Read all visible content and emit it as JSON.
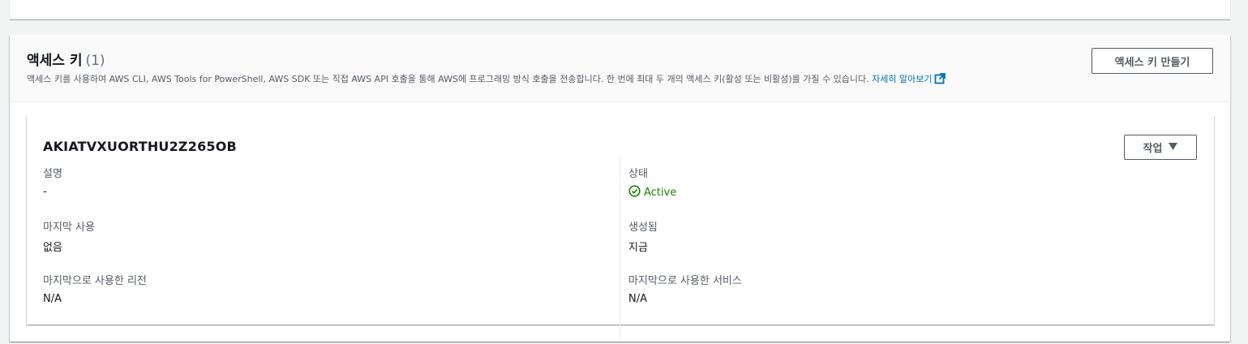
{
  "section": {
    "title": "액세스 키",
    "count": "(1)",
    "description": "액세스 키를 사용하여 AWS CLI, AWS Tools for PowerShell, AWS SDK 또는 직접 AWS API 호출을 통해 AWS에 프로그래밍 방식 호출을 전송합니다. 한 번에 최대 두 개의 액세스 키(활성 또는 비활성)를 가질 수 있습니다.",
    "learn_more": "자세히 알아보기",
    "create_button": "액세스 키 만들기"
  },
  "key": {
    "id": "AKIATVXUORTHU2Z265OB",
    "action_button": "작업",
    "fields": {
      "description_label": "설명",
      "description_value": "-",
      "status_label": "상태",
      "status_value": "Active",
      "last_used_label": "마지막 사용",
      "last_used_value": "없음",
      "created_label": "생성됨",
      "created_value": "지금",
      "last_region_label": "마지막으로 사용한 리전",
      "last_region_value": "N/A",
      "last_service_label": "마지막으로 사용한 서비스",
      "last_service_value": "N/A"
    }
  },
  "colors": {
    "link": "#0073bb",
    "active": "#1d8102",
    "label": "#545b64"
  }
}
